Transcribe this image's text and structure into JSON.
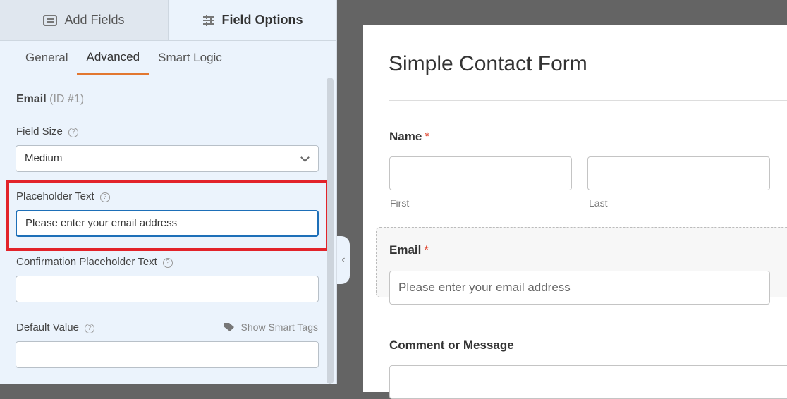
{
  "panel": {
    "tabs": [
      {
        "label": "Add Fields",
        "icon": "list-icon"
      },
      {
        "label": "Field Options",
        "icon": "sliders-icon"
      }
    ],
    "subtabs": [
      "General",
      "Advanced",
      "Smart Logic"
    ],
    "field_name": "Email",
    "field_id": "(ID #1)",
    "field_size_label": "Field Size",
    "field_size_value": "Medium",
    "placeholder_label": "Placeholder Text",
    "placeholder_value": "Please enter your email address",
    "confirm_label": "Confirmation Placeholder Text",
    "confirm_value": "",
    "default_label": "Default Value",
    "default_value": "",
    "smart_tags": "Show Smart Tags",
    "help": "?"
  },
  "preview": {
    "title": "Simple Contact Form",
    "name_label": "Name",
    "required": "*",
    "first": "First",
    "last": "Last",
    "email_label": "Email",
    "email_placeholder": "Please enter your email address",
    "comment_label": "Comment or Message"
  },
  "colors": {
    "accent": "#e27730",
    "highlight": "#e2232a",
    "focus": "#1d6fb8"
  }
}
